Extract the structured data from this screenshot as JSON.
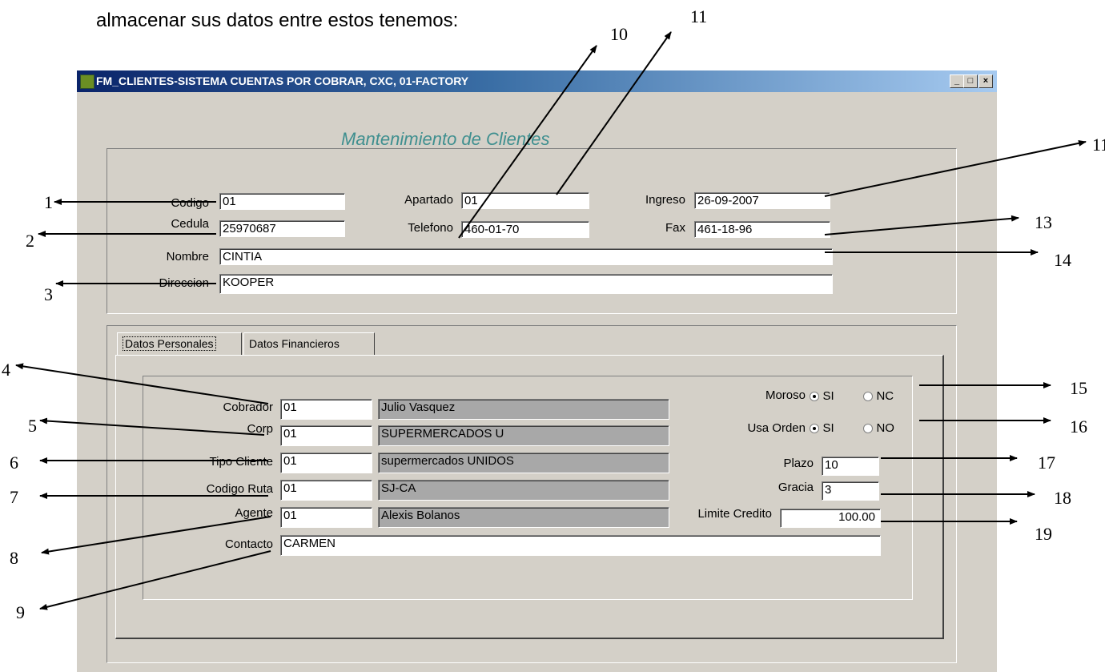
{
  "intro_text": "almacenar sus datos entre estos tenemos:",
  "window": {
    "title": "FM_CLIENTES-SISTEMA CUENTAS POR COBRAR, CXC, 01-FACTORY",
    "form_title": "Mantenimiento de Clientes",
    "controls": {
      "minimize": "_",
      "maximize": "□",
      "close": "×"
    }
  },
  "header_fields": {
    "codigo": {
      "label": "Codigo",
      "value": "01"
    },
    "cedula": {
      "label": "Cedula",
      "value": "25970687"
    },
    "nombre": {
      "label": "Nombre",
      "value": "CINTIA"
    },
    "direccion": {
      "label": "Direccion",
      "value": "KOOPER"
    },
    "apartado": {
      "label": "Apartado",
      "value": "01"
    },
    "telefono": {
      "label": "Telefono",
      "value": "460-01-70"
    },
    "ingreso": {
      "label": "Ingreso",
      "value": "26-09-2007"
    },
    "fax": {
      "label": "Fax",
      "value": "461-18-96"
    }
  },
  "tabs": [
    {
      "label": "Datos Personales",
      "active": true
    },
    {
      "label": "Datos Financieros",
      "active": false
    }
  ],
  "personal": {
    "cobrador": {
      "label": "Cobrador",
      "code": "01",
      "desc": "Julio Vasquez"
    },
    "corp": {
      "label": "Corp",
      "code": "01",
      "desc": "SUPERMERCADOS U"
    },
    "tipo_cliente": {
      "label": "Tipo Cliente",
      "code": "01",
      "desc": "supermercados UNIDOS"
    },
    "codigo_ruta": {
      "label": "Codigo Ruta",
      "code": "01",
      "desc": "SJ-CA"
    },
    "agente": {
      "label": "Agente",
      "code": "01",
      "desc": "Alexis Bolanos"
    },
    "contacto": {
      "label": "Contacto",
      "value": "CARMEN"
    },
    "moroso": {
      "label": "Moroso",
      "opt_si": "SI",
      "opt_no": "NC",
      "selected": "SI"
    },
    "usa_orden": {
      "label": "Usa Orden",
      "opt_si": "SI",
      "opt_no": "NO",
      "selected": "SI"
    },
    "plazo": {
      "label": "Plazo",
      "value": "10"
    },
    "gracia": {
      "label": "Gracia",
      "value": "3"
    },
    "limite_credito": {
      "label": "Limite Credito",
      "value": "100.00"
    }
  },
  "callouts": [
    "1",
    "2",
    "3",
    "4",
    "5",
    "6",
    "7",
    "8",
    "9",
    "10",
    "11",
    "11",
    "13",
    "14",
    "15",
    "16",
    "17",
    "18",
    "19"
  ]
}
